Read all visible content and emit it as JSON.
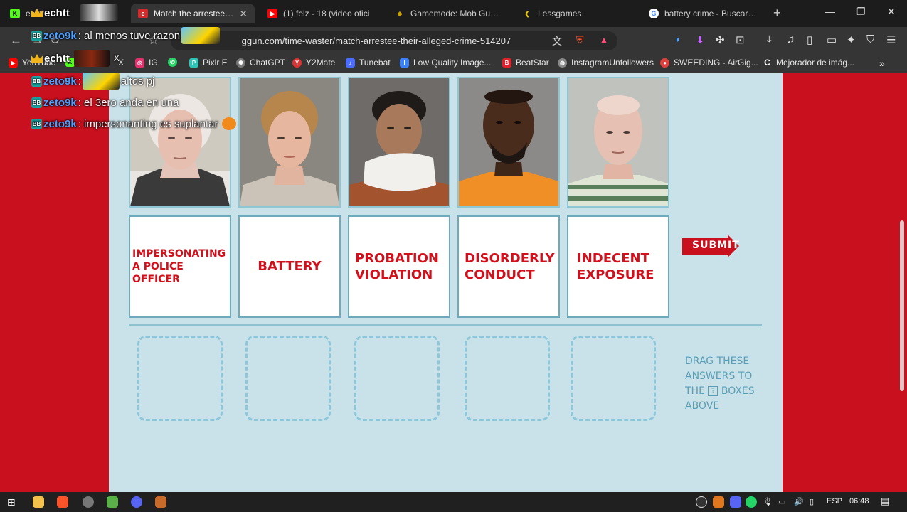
{
  "tabs": [
    {
      "title": "echtt",
      "favicon": "kick-icon",
      "color": "#53fc18"
    },
    {
      "title": "Match the arrestee wit",
      "favicon": "site-icon",
      "color": "#d62b2b",
      "active": true
    },
    {
      "title": "(1) felz - 18 (video ofici",
      "favicon": "youtube-icon",
      "color": "#ff0000"
    },
    {
      "title": "Gamemode: Mob Guesser",
      "favicon": "game-icon",
      "color": "#c8a200"
    },
    {
      "title": "Lessgames",
      "favicon": "game-icon",
      "color": "#e8c400"
    },
    {
      "title": "battery crime - Buscar con",
      "favicon": "google-icon",
      "color": "#4285f4"
    }
  ],
  "address": {
    "url": "ggun.com/time-waster/match-arrestee-their-alleged-crime-514207",
    "prefix": "t"
  },
  "bookmarks": [
    {
      "label": "YouTube",
      "icon": "youtube-icon",
      "color": "#ff0000"
    },
    {
      "label": "X",
      "icon": "x-icon",
      "color": "#000000"
    },
    {
      "label": "IG",
      "icon": "instagram-icon",
      "color": "#e1306c"
    },
    {
      "label": "",
      "icon": "whatsapp-icon",
      "color": "#25d366"
    },
    {
      "label": "Pixlr E",
      "icon": "pixlr-icon",
      "color": "#2ec4b6"
    },
    {
      "label": "ChatGPT",
      "icon": "chatgpt-icon",
      "color": "#777777"
    },
    {
      "label": "Y2Mate",
      "icon": "y2mate-icon",
      "color": "#d33"
    },
    {
      "label": "Tunebat",
      "icon": "tunebat-icon",
      "color": "#4a6cff"
    },
    {
      "label": "Low Quality Image...",
      "icon": "lqi-icon",
      "color": "#3b82f6"
    },
    {
      "label": "BeatStar",
      "icon": "beatstar-icon",
      "color": "#e0202a"
    },
    {
      "label": "InstagramUnfollowers",
      "icon": "globe-icon",
      "color": "#888888"
    },
    {
      "label": "SWEEDING - AirGig...",
      "icon": "airgig-icon",
      "color": "#e04040"
    },
    {
      "label": "Mejorador de imág...",
      "icon": "c-icon",
      "color": "#ffffff"
    }
  ],
  "game": {
    "crimes": [
      {
        "label": "IMPERSONATING A POLICE OFFICER",
        "size": "small"
      },
      {
        "label": "BATTERY",
        "size": "big"
      },
      {
        "label": "PROBATION VIOLATION",
        "size": "big"
      },
      {
        "label": "DISORDERLY CONDUCT",
        "size": "big"
      },
      {
        "label": "INDECENT EXPOSURE",
        "size": "big"
      }
    ],
    "submit_label": "SUBMIT",
    "instructions": [
      "DRAG THESE",
      "ANSWERS TO",
      "THE",
      "BOXES",
      "ABOVE"
    ],
    "qmark": "?"
  },
  "chat": [
    {
      "user": "echtt",
      "text": "",
      "badge": "crown"
    },
    {
      "user": "zeto9k",
      "text": ": al menos tuve razon",
      "badge": "bot"
    },
    {
      "user": "echtt",
      "text": "X",
      "badge": "crown"
    },
    {
      "user": "zeto9k",
      "text": ":",
      "text2": "altos pj",
      "badge": "bot"
    },
    {
      "user": "zeto9k",
      "text": ": el 3ero anda en una",
      "badge": "bot"
    },
    {
      "user": "zeto9k",
      "text": ": impersonanting es suplantar",
      "badge": "bot"
    }
  ],
  "taskbar": {
    "lang": "ESP",
    "time": "06:48"
  }
}
